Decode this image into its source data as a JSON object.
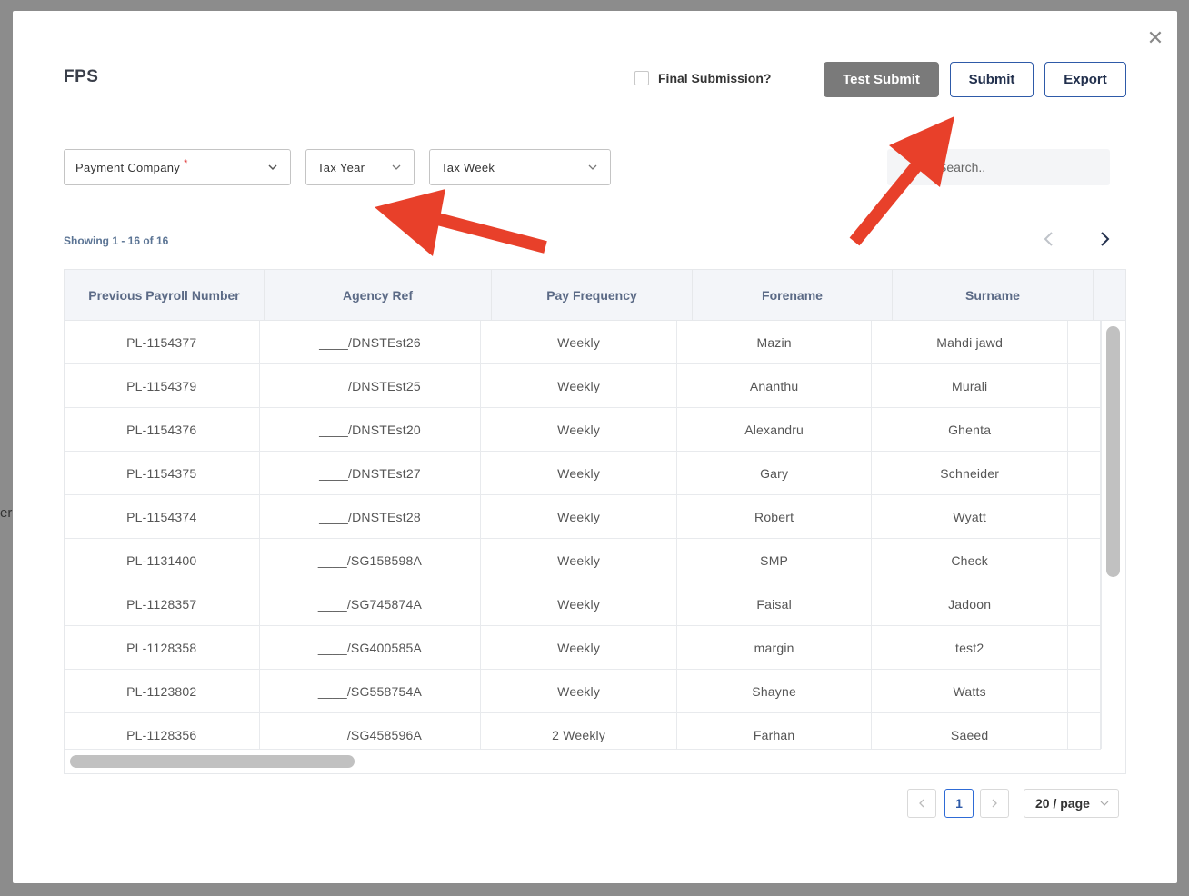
{
  "modal": {
    "title": "FPS",
    "close_icon": "close-icon",
    "final_submission_label": "Final Submission?",
    "buttons": {
      "test_submit": "Test Submit",
      "submit": "Submit",
      "export": "Export"
    }
  },
  "filters": {
    "payment_company": "Payment Company",
    "required_mark": "*",
    "tax_year": "Tax Year",
    "tax_week": "Tax Week",
    "search_placeholder": "Search.."
  },
  "showing_text": "Showing 1 - 16 of 16",
  "table": {
    "columns": [
      "Previous Payroll Number",
      "Agency Ref",
      "Pay Frequency",
      "Forename",
      "Surname"
    ],
    "rows": [
      [
        "PL-1154377",
        "____/DNSTEst26",
        "Weekly",
        "Mazin",
        "Mahdi jawd"
      ],
      [
        "PL-1154379",
        "____/DNSTEst25",
        "Weekly",
        "Ananthu",
        "Murali"
      ],
      [
        "PL-1154376",
        "____/DNSTEst20",
        "Weekly",
        "Alexandru",
        "Ghenta"
      ],
      [
        "PL-1154375",
        "____/DNSTEst27",
        "Weekly",
        "Gary",
        "Schneider"
      ],
      [
        "PL-1154374",
        "____/DNSTEst28",
        "Weekly",
        "Robert",
        "Wyatt"
      ],
      [
        "PL-1131400",
        "____/SG158598A",
        "Weekly",
        "SMP",
        "Check"
      ],
      [
        "PL-1128357",
        "____/SG745874A",
        "Weekly",
        "Faisal",
        "Jadoon"
      ],
      [
        "PL-1128358",
        "____/SG400585A",
        "Weekly",
        "margin",
        "test2"
      ],
      [
        "PL-1123802",
        "____/SG558754A",
        "Weekly",
        "Shayne",
        "Watts"
      ],
      [
        "PL-1128356",
        "____/SG458596A",
        "2 Weekly",
        "Farhan",
        "Saeed"
      ]
    ]
  },
  "pagination": {
    "current_page": "1",
    "page_size": "20 / page"
  },
  "background": {
    "fragment": "er"
  },
  "colors": {
    "annotation_arrow": "#e8402a",
    "primary_border": "#2e5aa8",
    "test_submit_bg": "#7a7a7a"
  }
}
